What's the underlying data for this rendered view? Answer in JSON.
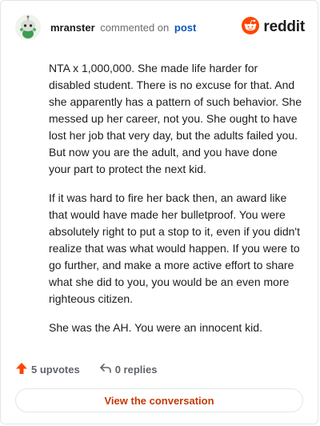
{
  "header": {
    "username": "mranster",
    "action_text": "commented on",
    "post_link": "post",
    "brand_name": "reddit"
  },
  "comment": {
    "paragraphs": [
      "NTA x 1,000,000. She made life harder for disabled student. There is no excuse for that. And she apparently has a pattern of such behavior. She messed up her career, not you. She ought to have lost her job that very day, but the adults failed you. But now you are the adult, and you have done your part to protect the next kid.",
      "If it was hard to fire her back then, an award like that would have made her bulletproof. You were absolutely right to put a stop to it, even if you didn't realize that was what would happen. If you were to go further, and make a more active effort to share what she did to you, you would be an even more righteous citizen.",
      "She was the AH. You were an innocent kid."
    ]
  },
  "footer": {
    "upvotes_label": "5 upvotes",
    "replies_label": "0 replies"
  },
  "cta": {
    "label": "View the conversation"
  },
  "colors": {
    "brand": "#ff4500",
    "link": "#0b57b8",
    "cta_text": "#c23a05",
    "upvote_arrow": "#ff4500"
  },
  "icons": {
    "avatar": "snoo-avatar-icon",
    "brand": "reddit-logo-icon",
    "upvote": "upvote-arrow-icon",
    "reply": "reply-arrow-icon"
  }
}
